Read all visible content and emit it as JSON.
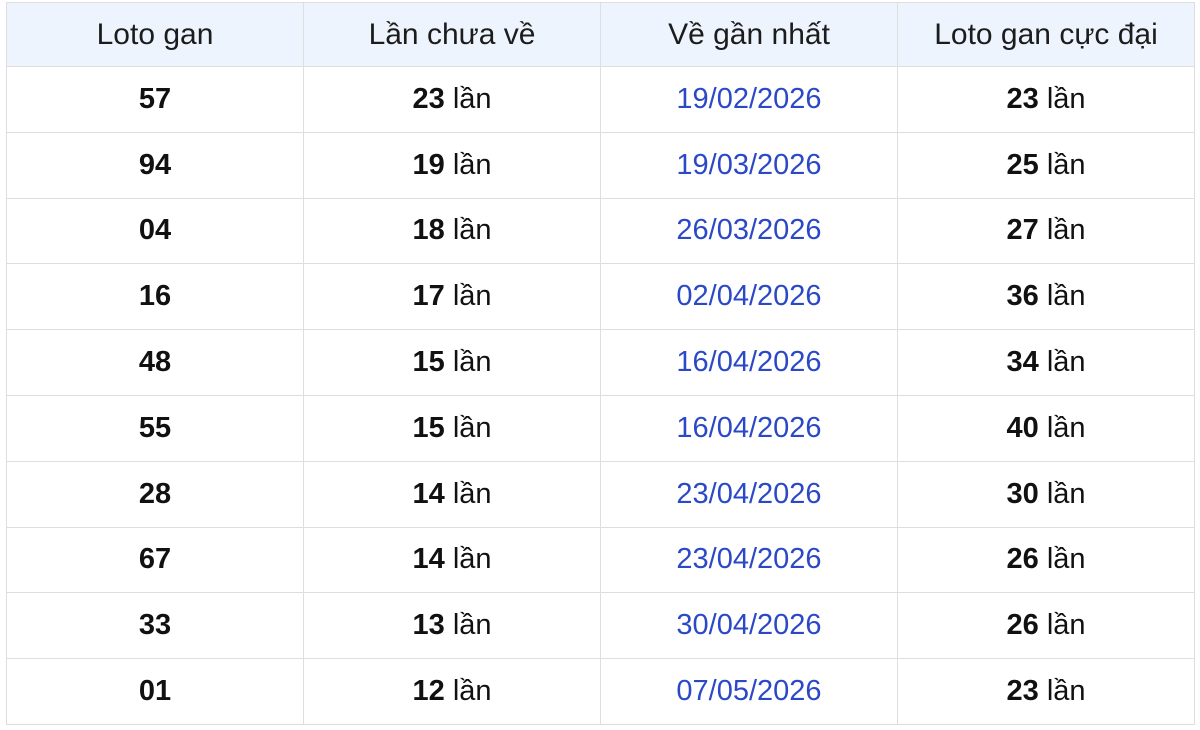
{
  "table": {
    "headers": [
      "Loto gan",
      "Lần chưa về",
      "Về gần nhất",
      "Loto gan cực đại"
    ],
    "unit": "lần",
    "rows": [
      {
        "loto": "57",
        "missed": "23",
        "last_date": "19/02/2026",
        "max_gap": "23"
      },
      {
        "loto": "94",
        "missed": "19",
        "last_date": "19/03/2026",
        "max_gap": "25"
      },
      {
        "loto": "04",
        "missed": "18",
        "last_date": "26/03/2026",
        "max_gap": "27"
      },
      {
        "loto": "16",
        "missed": "17",
        "last_date": "02/04/2026",
        "max_gap": "36"
      },
      {
        "loto": "48",
        "missed": "15",
        "last_date": "16/04/2026",
        "max_gap": "34"
      },
      {
        "loto": "55",
        "missed": "15",
        "last_date": "16/04/2026",
        "max_gap": "40"
      },
      {
        "loto": "28",
        "missed": "14",
        "last_date": "23/04/2026",
        "max_gap": "30"
      },
      {
        "loto": "67",
        "missed": "14",
        "last_date": "23/04/2026",
        "max_gap": "26"
      },
      {
        "loto": "33",
        "missed": "13",
        "last_date": "30/04/2026",
        "max_gap": "26"
      },
      {
        "loto": "01",
        "missed": "12",
        "last_date": "07/05/2026",
        "max_gap": "23"
      }
    ]
  },
  "colors": {
    "header_bg": "#eef4fd",
    "border": "#dedede",
    "date_text": "#2b49c7",
    "text": "#111111"
  }
}
